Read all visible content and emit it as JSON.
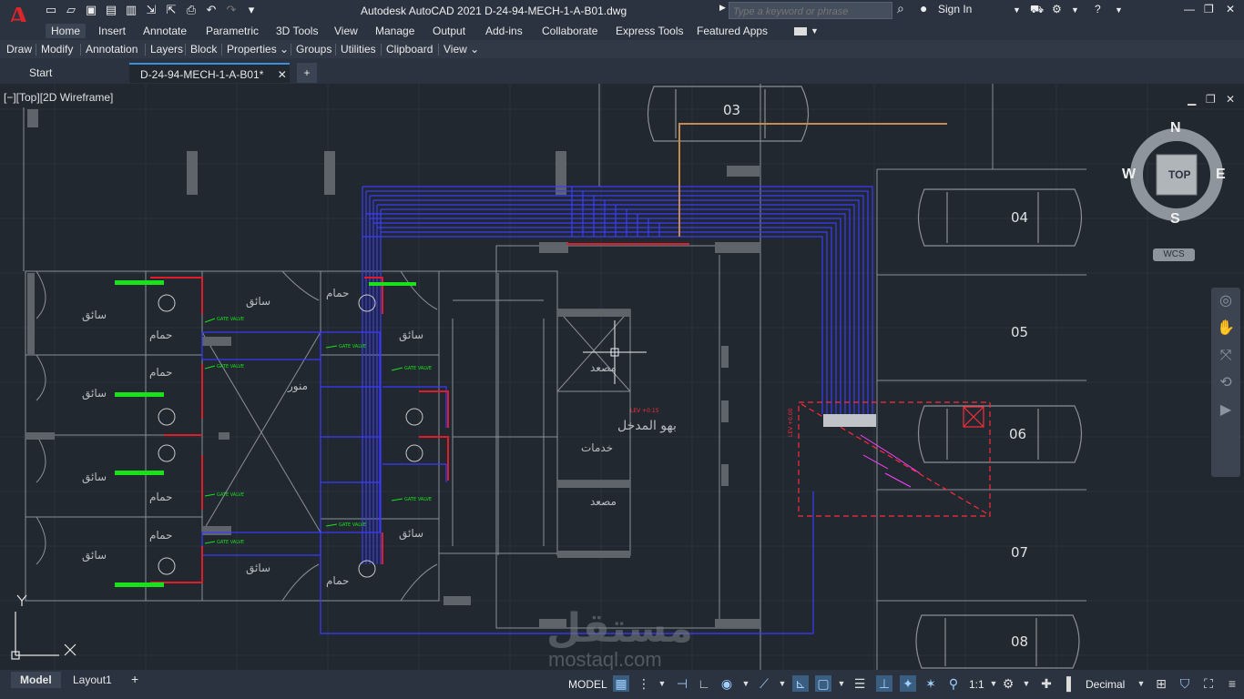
{
  "app": {
    "logo_letter": "A",
    "title": "Autodesk AutoCAD 2021    D-24-94-MECH-1-A-B01.dwg",
    "search_placeholder": "Type a keyword or phrase",
    "sign_in": "Sign In"
  },
  "ribbon_tabs": [
    "Home",
    "Insert",
    "Annotate",
    "Parametric",
    "3D Tools",
    "View",
    "Manage",
    "Output",
    "Add-ins",
    "Collaborate",
    "Express Tools",
    "Featured Apps"
  ],
  "panels": [
    "Draw",
    "Modify",
    "Annotation",
    "Layers",
    "Block",
    "Properties ⌄",
    "Groups",
    "Utilities",
    "Clipboard",
    "View ⌄"
  ],
  "doc_tabs": {
    "start": "Start",
    "active": "D-24-94-MECH-1-A-B01*",
    "add": "+"
  },
  "viewport": {
    "label": "[−][Top][2D Wireframe]"
  },
  "viewcube": {
    "top": "TOP",
    "n": "N",
    "s": "S",
    "e": "E",
    "w": "W",
    "wcs": "WCS"
  },
  "drawing": {
    "parking": [
      "03",
      "04",
      "05",
      "06",
      "07",
      "08"
    ],
    "rooms": {
      "driver": "سائق",
      "bath": "حمام",
      "stairs_light": "منور",
      "elevator": "مصعد",
      "services": "خدمات",
      "entrance": "بهو المدخل"
    },
    "labels": {
      "gate_valve": "GATE VALVE",
      "level_1": "LEV +0.15",
      "level_2": "LEV +0.00"
    }
  },
  "layout_tabs": {
    "model": "Model",
    "layout1": "Layout1",
    "add": "+"
  },
  "status": {
    "mode": "MODEL",
    "scale": "1:1",
    "units": "Decimal"
  },
  "watermark": {
    "ar": "مستقل",
    "en": "mostaql.com"
  }
}
